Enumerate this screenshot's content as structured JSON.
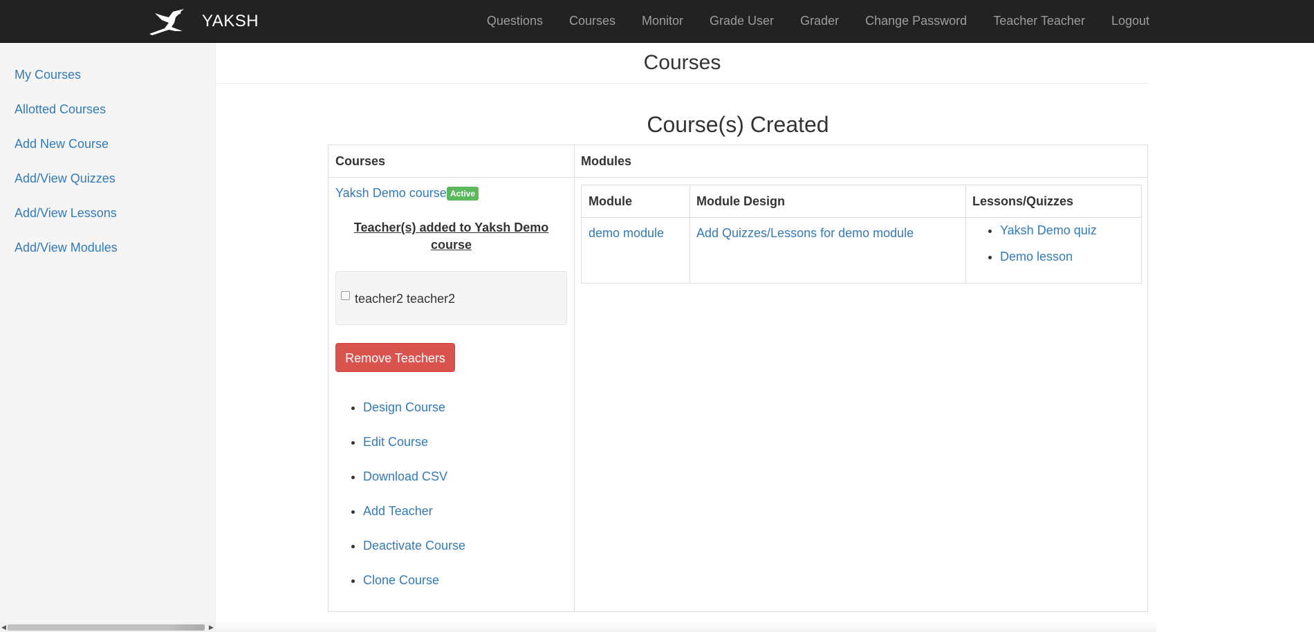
{
  "navbar": {
    "brand": "YAKSH",
    "links": [
      {
        "label": "Questions"
      },
      {
        "label": "Courses"
      },
      {
        "label": "Monitor"
      },
      {
        "label": "Grade User"
      },
      {
        "label": "Grader"
      },
      {
        "label": "Change Password"
      },
      {
        "label": "Teacher Teacher"
      },
      {
        "label": "Logout"
      }
    ]
  },
  "sidebar": {
    "items": [
      {
        "label": "My Courses"
      },
      {
        "label": "Allotted Courses"
      },
      {
        "label": "Add New Course"
      },
      {
        "label": "Add/View Quizzes"
      },
      {
        "label": "Add/View Lessons"
      },
      {
        "label": "Add/View Modules"
      }
    ]
  },
  "page": {
    "title": "Courses",
    "section_title": "Course(s) Created"
  },
  "table": {
    "headers": {
      "courses": "Courses",
      "modules": "Modules"
    },
    "course": {
      "name": "Yaksh Demo course",
      "status_badge": "Active",
      "teachers_heading": "Teacher(s) added to Yaksh Demo course",
      "teachers": [
        {
          "name": "teacher2 teacher2",
          "checked": false
        }
      ],
      "remove_button": "Remove Teachers",
      "actions": [
        {
          "label": "Design Course"
        },
        {
          "label": "Edit Course"
        },
        {
          "label": "Download CSV"
        },
        {
          "label": "Add Teacher"
        },
        {
          "label": "Deactivate Course"
        },
        {
          "label": "Clone Course"
        }
      ]
    },
    "modules": {
      "headers": {
        "module": "Module",
        "design": "Module Design",
        "lessons": "Lessons/Quizzes"
      },
      "rows": [
        {
          "module": "demo module",
          "design": "Add Quizzes/Lessons for demo module",
          "units": [
            "Yaksh Demo quiz",
            "Demo lesson"
          ]
        }
      ]
    }
  },
  "colors": {
    "navbar_bg": "#222222",
    "nav_link": "#9d9d9d",
    "link": "#337ab7",
    "danger": "#d9534f",
    "success": "#5cb85c",
    "sidebar_bg": "#f5f5f5"
  }
}
